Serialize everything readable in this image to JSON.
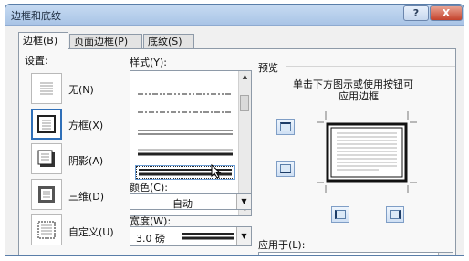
{
  "window": {
    "title": "边框和底纹",
    "help_label": "?",
    "close_label": "X"
  },
  "tabs": [
    {
      "label": "边框(B)",
      "active": true
    },
    {
      "label": "页面边框(P)",
      "active": false
    },
    {
      "label": "底纹(S)",
      "active": false
    }
  ],
  "settings": {
    "heading": "设置:",
    "items": [
      {
        "label": "无(N)",
        "icon": "no-border-icon",
        "selected": false
      },
      {
        "label": "方框(X)",
        "icon": "box-border-icon",
        "selected": true
      },
      {
        "label": "阴影(A)",
        "icon": "shadow-border-icon",
        "selected": false
      },
      {
        "label": "三维(D)",
        "icon": "3d-border-icon",
        "selected": false
      },
      {
        "label": "自定义(U)",
        "icon": "custom-border-icon",
        "selected": false
      }
    ]
  },
  "style": {
    "label": "样式(Y):",
    "line_styles": [
      "dash-dot-dot",
      "dash-dot",
      "double",
      "thick-thin",
      "thick-double-selected"
    ],
    "selected_index": 4
  },
  "color": {
    "label": "颜色(C):",
    "value": "自动"
  },
  "width": {
    "label": "宽度(W):",
    "value": "3.0 磅"
  },
  "preview": {
    "heading": "预览",
    "hint_line1": "单击下方图示或使用按钮可",
    "hint_line2": "应用边框"
  },
  "apply_to": {
    "label": "应用于(L):"
  }
}
